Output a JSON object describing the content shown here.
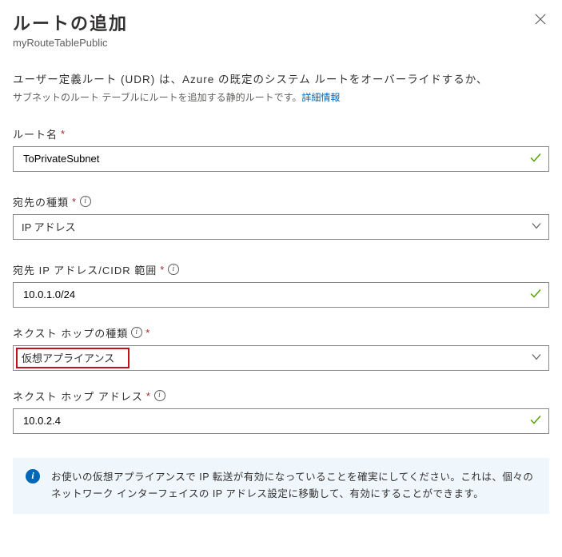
{
  "header": {
    "title": "ルートの追加",
    "subtitle": "myRouteTablePublic"
  },
  "description": {
    "main": "ユーザー定義ルート (UDR) は、Azure の既定のシステム ルートをオーバーライドするか、",
    "sub_prefix": "サブネットのルート テーブルにルートを追加する静的ルートです。",
    "link": "詳細情報"
  },
  "fields": {
    "route_name": {
      "label": "ルート名",
      "value": "ToPrivateSubnet"
    },
    "dest_type": {
      "label": "宛先の種類",
      "value": "IP アドレス"
    },
    "dest_cidr": {
      "label": "宛先 IP アドレス/CIDR 範囲",
      "value": "10.0.1.0/24"
    },
    "hop_type": {
      "label": "ネクスト ホップの種類",
      "value": "仮想アプライアンス"
    },
    "hop_addr": {
      "label": "ネクスト ホップ アドレス",
      "value": "10.0.2.4"
    }
  },
  "banner": {
    "text": "お使いの仮想アプライアンスで IP 転送が有効になっていることを確実にしてください。これは、個々のネットワーク インターフェイスの IP アドレス設定に移動して、有効にすることができます。"
  }
}
